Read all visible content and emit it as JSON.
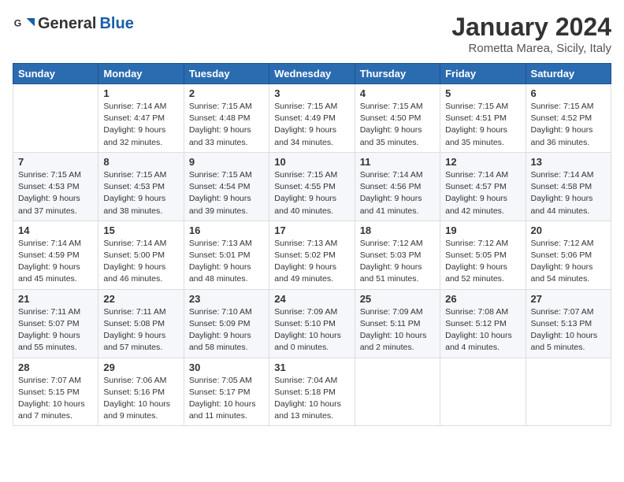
{
  "header": {
    "logo_general": "General",
    "logo_blue": "Blue",
    "month_year": "January 2024",
    "location": "Rometta Marea, Sicily, Italy"
  },
  "days_of_week": [
    "Sunday",
    "Monday",
    "Tuesday",
    "Wednesday",
    "Thursday",
    "Friday",
    "Saturday"
  ],
  "weeks": [
    [
      {
        "day": null,
        "info": null
      },
      {
        "day": "1",
        "sunrise": "7:14 AM",
        "sunset": "4:47 PM",
        "daylight": "9 hours and 32 minutes."
      },
      {
        "day": "2",
        "sunrise": "7:15 AM",
        "sunset": "4:48 PM",
        "daylight": "9 hours and 33 minutes."
      },
      {
        "day": "3",
        "sunrise": "7:15 AM",
        "sunset": "4:49 PM",
        "daylight": "9 hours and 34 minutes."
      },
      {
        "day": "4",
        "sunrise": "7:15 AM",
        "sunset": "4:50 PM",
        "daylight": "9 hours and 35 minutes."
      },
      {
        "day": "5",
        "sunrise": "7:15 AM",
        "sunset": "4:51 PM",
        "daylight": "9 hours and 35 minutes."
      },
      {
        "day": "6",
        "sunrise": "7:15 AM",
        "sunset": "4:52 PM",
        "daylight": "9 hours and 36 minutes."
      }
    ],
    [
      {
        "day": "7",
        "sunrise": "7:15 AM",
        "sunset": "4:53 PM",
        "daylight": "9 hours and 37 minutes."
      },
      {
        "day": "8",
        "sunrise": "7:15 AM",
        "sunset": "4:53 PM",
        "daylight": "9 hours and 38 minutes."
      },
      {
        "day": "9",
        "sunrise": "7:15 AM",
        "sunset": "4:54 PM",
        "daylight": "9 hours and 39 minutes."
      },
      {
        "day": "10",
        "sunrise": "7:15 AM",
        "sunset": "4:55 PM",
        "daylight": "9 hours and 40 minutes."
      },
      {
        "day": "11",
        "sunrise": "7:14 AM",
        "sunset": "4:56 PM",
        "daylight": "9 hours and 41 minutes."
      },
      {
        "day": "12",
        "sunrise": "7:14 AM",
        "sunset": "4:57 PM",
        "daylight": "9 hours and 42 minutes."
      },
      {
        "day": "13",
        "sunrise": "7:14 AM",
        "sunset": "4:58 PM",
        "daylight": "9 hours and 44 minutes."
      }
    ],
    [
      {
        "day": "14",
        "sunrise": "7:14 AM",
        "sunset": "4:59 PM",
        "daylight": "9 hours and 45 minutes."
      },
      {
        "day": "15",
        "sunrise": "7:14 AM",
        "sunset": "5:00 PM",
        "daylight": "9 hours and 46 minutes."
      },
      {
        "day": "16",
        "sunrise": "7:13 AM",
        "sunset": "5:01 PM",
        "daylight": "9 hours and 48 minutes."
      },
      {
        "day": "17",
        "sunrise": "7:13 AM",
        "sunset": "5:02 PM",
        "daylight": "9 hours and 49 minutes."
      },
      {
        "day": "18",
        "sunrise": "7:12 AM",
        "sunset": "5:03 PM",
        "daylight": "9 hours and 51 minutes."
      },
      {
        "day": "19",
        "sunrise": "7:12 AM",
        "sunset": "5:05 PM",
        "daylight": "9 hours and 52 minutes."
      },
      {
        "day": "20",
        "sunrise": "7:12 AM",
        "sunset": "5:06 PM",
        "daylight": "9 hours and 54 minutes."
      }
    ],
    [
      {
        "day": "21",
        "sunrise": "7:11 AM",
        "sunset": "5:07 PM",
        "daylight": "9 hours and 55 minutes."
      },
      {
        "day": "22",
        "sunrise": "7:11 AM",
        "sunset": "5:08 PM",
        "daylight": "9 hours and 57 minutes."
      },
      {
        "day": "23",
        "sunrise": "7:10 AM",
        "sunset": "5:09 PM",
        "daylight": "9 hours and 58 minutes."
      },
      {
        "day": "24",
        "sunrise": "7:09 AM",
        "sunset": "5:10 PM",
        "daylight": "10 hours and 0 minutes."
      },
      {
        "day": "25",
        "sunrise": "7:09 AM",
        "sunset": "5:11 PM",
        "daylight": "10 hours and 2 minutes."
      },
      {
        "day": "26",
        "sunrise": "7:08 AM",
        "sunset": "5:12 PM",
        "daylight": "10 hours and 4 minutes."
      },
      {
        "day": "27",
        "sunrise": "7:07 AM",
        "sunset": "5:13 PM",
        "daylight": "10 hours and 5 minutes."
      }
    ],
    [
      {
        "day": "28",
        "sunrise": "7:07 AM",
        "sunset": "5:15 PM",
        "daylight": "10 hours and 7 minutes."
      },
      {
        "day": "29",
        "sunrise": "7:06 AM",
        "sunset": "5:16 PM",
        "daylight": "10 hours and 9 minutes."
      },
      {
        "day": "30",
        "sunrise": "7:05 AM",
        "sunset": "5:17 PM",
        "daylight": "10 hours and 11 minutes."
      },
      {
        "day": "31",
        "sunrise": "7:04 AM",
        "sunset": "5:18 PM",
        "daylight": "10 hours and 13 minutes."
      },
      {
        "day": null,
        "info": null
      },
      {
        "day": null,
        "info": null
      },
      {
        "day": null,
        "info": null
      }
    ]
  ]
}
